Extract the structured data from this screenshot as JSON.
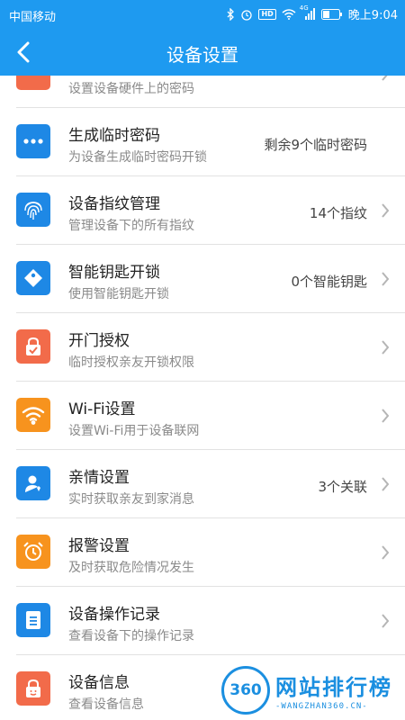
{
  "status_bar": {
    "carrier": "中国移动",
    "network": "4G",
    "time": "晚上9:04"
  },
  "header": {
    "title": "设备设置"
  },
  "partial_row": {
    "sub": "设置设备硬件上的密码"
  },
  "rows": [
    {
      "label": "生成临时密码",
      "sub": "为设备生成临时密码开锁",
      "value": "剩余9个临时密码",
      "icon": "dots-icon",
      "color": "#1e88e5"
    },
    {
      "label": "设备指纹管理",
      "sub": "管理设备下的所有指纹",
      "value": "14个指纹",
      "icon": "fingerprint-icon",
      "color": "#1e88e5"
    },
    {
      "label": "智能钥匙开锁",
      "sub": "使用智能钥匙开锁",
      "value": "0个智能钥匙",
      "icon": "key-tag-icon",
      "color": "#1e88e5"
    },
    {
      "label": "开门授权",
      "sub": "临时授权亲友开锁权限",
      "value": "",
      "icon": "lock-check-icon",
      "color": "#f26b4a"
    },
    {
      "label": "Wi-Fi设置",
      "sub": "设置Wi-Fi用于设备联网",
      "value": "",
      "icon": "wifi-icon",
      "color": "#f7931e"
    },
    {
      "label": "亲情设置",
      "sub": "实时获取亲友到家消息",
      "value": "3个关联",
      "icon": "family-icon",
      "color": "#1e88e5"
    },
    {
      "label": "报警设置",
      "sub": "及时获取危险情况发生",
      "value": "",
      "icon": "alarm-clock-icon",
      "color": "#f7931e"
    },
    {
      "label": "设备操作记录",
      "sub": "查看设备下的操作记录",
      "value": "",
      "icon": "document-icon",
      "color": "#1e88e5"
    },
    {
      "label": "设备信息",
      "sub": "查看设备信息",
      "value": "",
      "icon": "lock-face-icon",
      "color": "#f26b4a"
    }
  ],
  "watermark": {
    "badge": "360",
    "title": "网站排行榜",
    "subtitle": "-WANGZHAN360.CN-"
  }
}
